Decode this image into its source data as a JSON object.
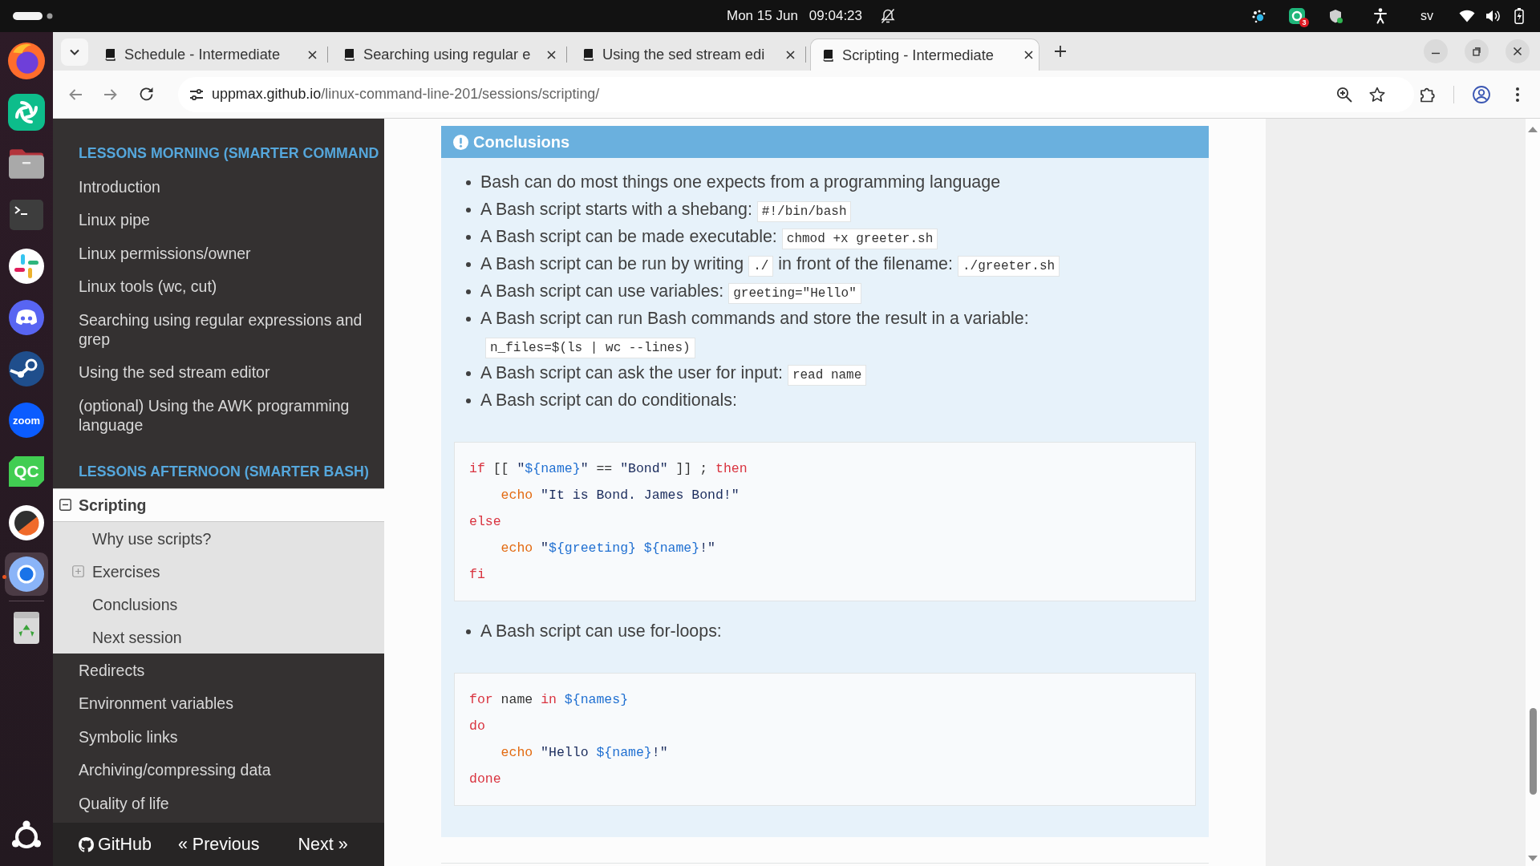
{
  "top_bar": {
    "date": "Mon 15 Jun",
    "time": "09:04:23",
    "notification_count": "3",
    "keyboard_layout": "sv"
  },
  "dock": {
    "items": [
      {
        "kind": "fox-globe",
        "active": false
      },
      {
        "kind": "swirl",
        "active": false
      },
      {
        "kind": "folder",
        "active": false
      },
      {
        "kind": "terminal",
        "active": false
      },
      {
        "kind": "pinwheel",
        "active": false
      },
      {
        "kind": "chat-face",
        "active": false
      },
      {
        "kind": "piston",
        "active": false
      },
      {
        "kind": "round-tile",
        "label": "zoom",
        "active": false
      },
      {
        "kind": "angled-tile",
        "label": "QC",
        "active": false
      },
      {
        "kind": "split-disc",
        "active": false
      },
      {
        "kind": "ring",
        "active": true
      }
    ]
  },
  "browser": {
    "tabs": [
      {
        "title": "Schedule - Intermediate",
        "selected": false
      },
      {
        "title": "Searching using regular e",
        "selected": false
      },
      {
        "title": "Using the sed stream edi",
        "selected": false
      },
      {
        "title": "Scripting - Intermediate",
        "selected": true
      }
    ],
    "address": {
      "host": "uppmax.github.io",
      "path": "/linux-command-line-201/sessions/scripting/"
    }
  },
  "sidebar": {
    "sections": [
      {
        "caption": "LESSONS MORNING (SMARTER COMMAND",
        "items": [
          {
            "label": "Introduction",
            "selected": false
          },
          {
            "label": "Linux pipe",
            "selected": false
          },
          {
            "label": "Linux permissions/owner",
            "selected": false
          },
          {
            "label": "Linux tools (wc, cut)",
            "selected": false
          },
          {
            "label": "Searching using regular expressions and grep",
            "selected": false
          },
          {
            "label": "Using the sed stream editor",
            "selected": false
          },
          {
            "label": "(optional) Using the AWK programming language",
            "selected": false
          }
        ]
      },
      {
        "caption": "LESSONS AFTERNOON (SMARTER BASH)",
        "items": [
          {
            "label": "Scripting",
            "selected": true,
            "expanded": true,
            "children": [
              {
                "label": "Why use scripts?",
                "selected": false
              },
              {
                "label": "Exercises",
                "selected": false,
                "expanded": false
              },
              {
                "label": "Conclusions",
                "selected": false
              },
              {
                "label": "Next session",
                "selected": false
              }
            ]
          },
          {
            "label": "Redirects",
            "selected": false
          },
          {
            "label": "Environment variables",
            "selected": false
          },
          {
            "label": "Symbolic links",
            "selected": false
          },
          {
            "label": "Archiving/compressing data",
            "selected": false
          },
          {
            "label": "Quality of life",
            "selected": false
          }
        ]
      }
    ],
    "footer": {
      "source_link": "GitHub",
      "previous": "« Previous",
      "next": "Next »"
    }
  },
  "content": {
    "admonition": {
      "title": "Conclusions",
      "blocks": [
        {
          "kind": "list",
          "items": [
            {
              "parts": [
                {
                  "kind": "text",
                  "text": "Bash can do most things one expects from a programming language"
                }
              ]
            },
            {
              "parts": [
                {
                  "kind": "text",
                  "text": "A Bash script starts with a shebang:"
                },
                {
                  "kind": "code",
                  "text": "#!/bin/bash"
                }
              ]
            },
            {
              "parts": [
                {
                  "kind": "text",
                  "text": "A Bash script can be made executable:"
                },
                {
                  "kind": "code",
                  "text": "chmod +x greeter.sh"
                }
              ]
            },
            {
              "parts": [
                {
                  "kind": "text",
                  "text": "A Bash script can be run by writing"
                },
                {
                  "kind": "code",
                  "text": "./"
                },
                {
                  "kind": "text",
                  "text": "in front of the filename:"
                },
                {
                  "kind": "code",
                  "text": "./greeter.sh"
                }
              ]
            },
            {
              "parts": [
                {
                  "kind": "text",
                  "text": "A Bash script can use variables:"
                },
                {
                  "kind": "code",
                  "text": "greeting=\"Hello\""
                }
              ]
            },
            {
              "parts": [
                {
                  "kind": "text",
                  "text": "A Bash script can run Bash commands and store the result in a variable:"
                },
                {
                  "kind": "code",
                  "text": "n_files=$(ls | wc --lines)"
                }
              ]
            },
            {
              "parts": [
                {
                  "kind": "text",
                  "text": "A Bash script can ask the user for input:"
                },
                {
                  "kind": "code",
                  "text": "read name"
                }
              ]
            },
            {
              "parts": [
                {
                  "kind": "text",
                  "text": "A Bash script can do conditionals:"
                }
              ]
            }
          ]
        },
        {
          "kind": "code",
          "lines": [
            [
              {
                "kind": "keyword",
                "text": "if"
              },
              {
                "kind": "plain",
                "text": " [[ "
              },
              {
                "kind": "string",
                "text": "\""
              },
              {
                "kind": "variable",
                "text": "${name}"
              },
              {
                "kind": "string",
                "text": "\""
              },
              {
                "kind": "plain",
                "text": " == "
              },
              {
                "kind": "string",
                "text": "\"Bond\""
              },
              {
                "kind": "plain",
                "text": " ]] ; "
              },
              {
                "kind": "keyword",
                "text": "then"
              }
            ],
            [
              {
                "kind": "builtin",
                "text": "    echo"
              },
              {
                "kind": "string",
                "text": " \"It is Bond. James Bond!\""
              }
            ],
            [
              {
                "kind": "keyword",
                "text": "else"
              }
            ],
            [
              {
                "kind": "builtin",
                "text": "    echo"
              },
              {
                "kind": "string",
                "text": " \""
              },
              {
                "kind": "variable",
                "text": "${greeting}"
              },
              {
                "kind": "variable",
                "text": " ${name}"
              },
              {
                "kind": "string",
                "text": "!\""
              }
            ],
            [
              {
                "kind": "keyword",
                "text": "fi"
              }
            ]
          ]
        },
        {
          "kind": "list",
          "items": [
            {
              "parts": [
                {
                  "kind": "text",
                  "text": "A Bash script can use for-loops:"
                }
              ]
            }
          ]
        },
        {
          "kind": "code",
          "lines": [
            [
              {
                "kind": "keyword",
                "text": "for"
              },
              {
                "kind": "plain",
                "text": " name "
              },
              {
                "kind": "keyword",
                "text": "in"
              },
              {
                "kind": "variable",
                "text": " ${names}"
              }
            ],
            [
              {
                "kind": "keyword",
                "text": "do"
              }
            ],
            [
              {
                "kind": "builtin",
                "text": "    echo"
              },
              {
                "kind": "string",
                "text": " \"Hello "
              },
              {
                "kind": "variable",
                "text": "${name}"
              },
              {
                "kind": "string",
                "text": "!\""
              }
            ],
            [
              {
                "kind": "keyword",
                "text": "done"
              }
            ]
          ]
        }
      ]
    }
  }
}
